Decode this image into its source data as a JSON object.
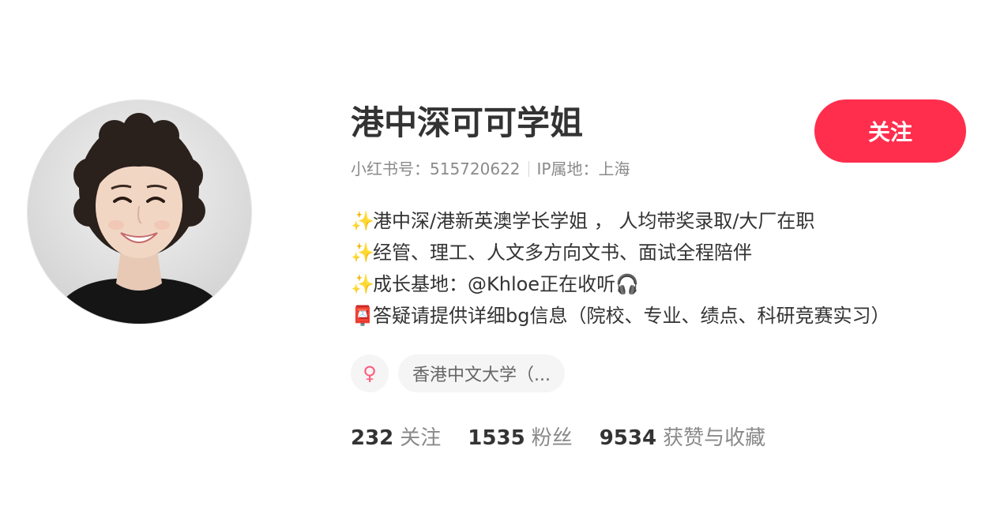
{
  "profile": {
    "name": "港中深可可学姐",
    "id_label": "小红书号：",
    "id_value": "515720622",
    "ip_label": "IP属地：",
    "ip_value": "上海",
    "follow_label": "关注"
  },
  "bio": {
    "lines": [
      {
        "icon": "sparkles-icon",
        "glyph": "✨",
        "text": "港中深/港新英澳学长学姐 ， 人均带奖录取/大厂在职"
      },
      {
        "icon": "sparkles-icon",
        "glyph": "✨",
        "text": "经管、理工、人文多方向文书、面试全程陪伴"
      },
      {
        "icon": "sparkles-icon",
        "glyph": "✨",
        "text": "成长基地：@Khloe正在收听"
      },
      {
        "icon": "mailbox-icon",
        "glyph": "📮",
        "text": "答疑请提供详细bg信息（院校、专业、绩点、科研竞赛实习）"
      }
    ],
    "headphone_icon": "headphones-icon",
    "headphone_glyph": "🎧"
  },
  "tags": {
    "gender_icon": "female-icon",
    "gender_glyph": "♀",
    "school": "香港中文大学（..."
  },
  "stats": [
    {
      "value": "232",
      "label": "关注"
    },
    {
      "value": "1535",
      "label": "粉丝"
    },
    {
      "value": "9534",
      "label": "获赞与收藏"
    }
  ],
  "colors": {
    "accent": "#ff2e4d",
    "text_primary": "#333333",
    "text_secondary": "#8a8a8a",
    "tag_bg": "#f5f5f5",
    "female": "#ff5c7c"
  }
}
